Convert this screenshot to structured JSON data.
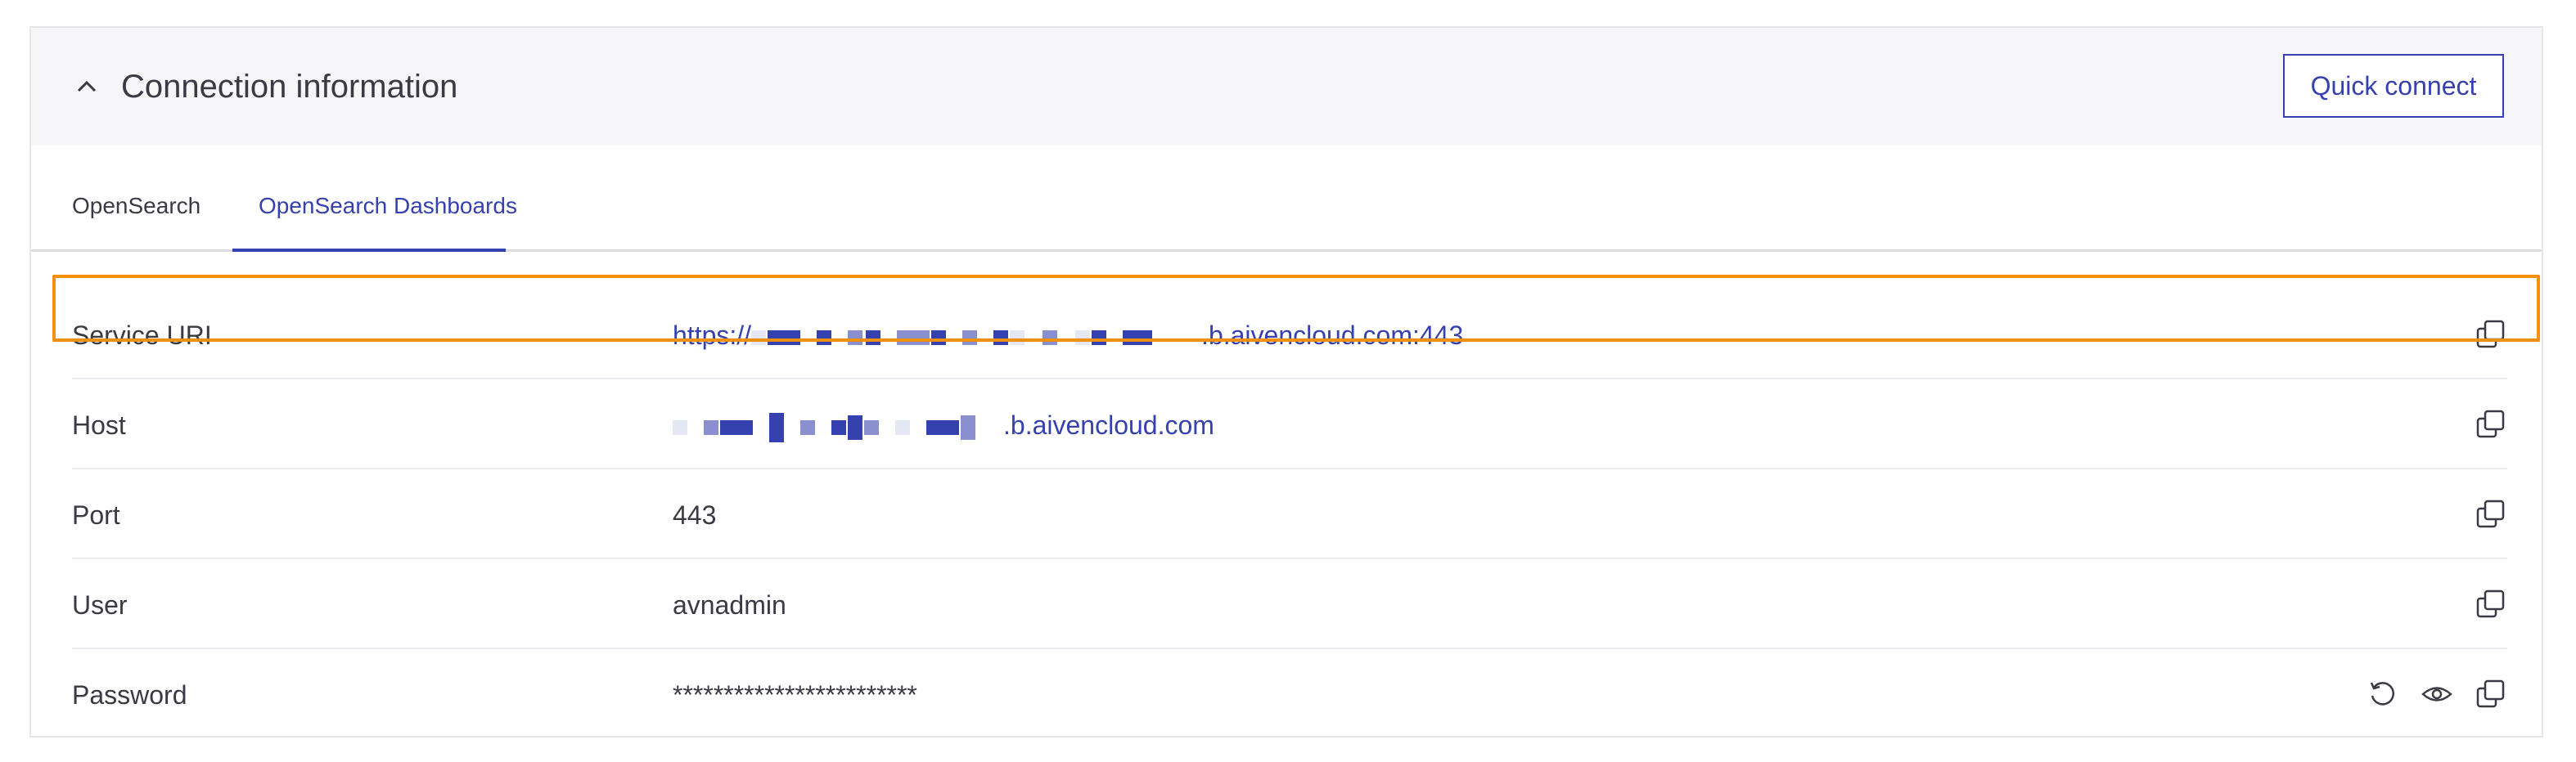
{
  "panel": {
    "title": "Connection information",
    "quick_connect_label": "Quick connect"
  },
  "tabs": [
    {
      "label": "OpenSearch",
      "active": false
    },
    {
      "label": "OpenSearch Dashboards",
      "active": true
    }
  ],
  "fields": [
    {
      "label": "Service URI",
      "value_prefix": "https://",
      "value_suffix": ".b.aivencloud.com:443",
      "redacted": true,
      "highlighted": true
    },
    {
      "label": "Host",
      "value_suffix": ".b.aivencloud.com",
      "redacted": true
    },
    {
      "label": "Port",
      "value": "443"
    },
    {
      "label": "User",
      "value": "avnadmin"
    },
    {
      "label": "Password",
      "value": "************************"
    }
  ],
  "colors": {
    "accent": "#3641b0",
    "highlight": "#f5900f",
    "header_bg": "#f6f6f8",
    "text": "#3a3a44"
  },
  "icons": {
    "collapse": "chevron-up-icon",
    "copy": "copy-icon",
    "reset": "reset-icon",
    "reveal": "eye-icon"
  }
}
